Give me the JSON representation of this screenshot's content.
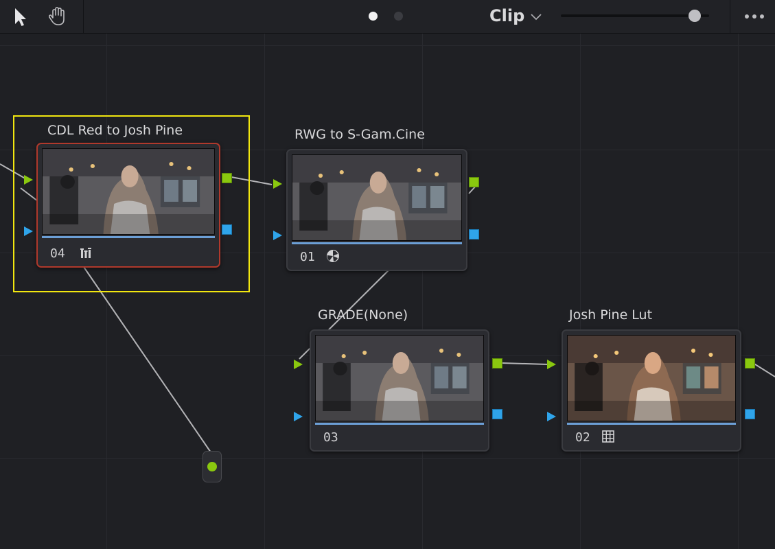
{
  "toolbar": {
    "tools": [
      {
        "name": "pointer-tool",
        "icon": "arrow-pointer-icon"
      },
      {
        "name": "hand-tool",
        "icon": "hand-icon"
      }
    ],
    "page_indicator": {
      "pages": 2,
      "active_index": 0
    },
    "mode_label": "Clip",
    "zoom_level": 0.9,
    "more_icon": "more-dots-icon"
  },
  "nodes": [
    {
      "label": "CDL Red to Josh Pine",
      "number": "04",
      "icon": "rgb-mixer-icon",
      "selected": true
    },
    {
      "label": "RWG to S-Gam.Cine",
      "number": "01",
      "icon": "color-space-transform-icon",
      "selected": false
    },
    {
      "label": "GRADE(None)",
      "number": "03",
      "icon": "",
      "selected": false
    },
    {
      "label": "Josh Pine Lut",
      "number": "02",
      "icon": "lut-grid-icon",
      "selected": false
    }
  ],
  "colors": {
    "background": "#1f2024",
    "rgb_port": "#8ac80f",
    "alpha_port": "#2fa4ea",
    "selection_highlight": "#f2e70f",
    "selected_node_border": "#b0392c"
  }
}
